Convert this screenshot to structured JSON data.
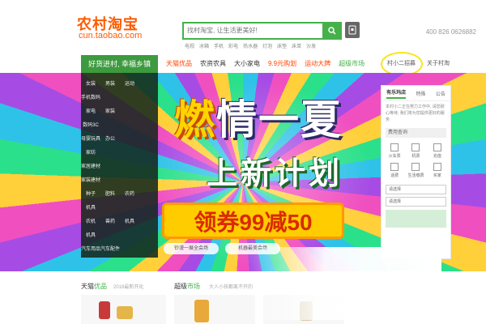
{
  "header": {
    "logo_cn": "农村淘宝",
    "logo_en": "cun.taobao.com",
    "search_placeholder": "找村淘宝, 让生活更美好!",
    "hotwords": [
      "电视",
      "冰箱",
      "手机",
      "彩电",
      "热水器",
      "灯泡",
      "床垫",
      "床单",
      "沙发"
    ],
    "hotline": "400 826 0626882"
  },
  "nav": {
    "categories_label": "好货进村, 幸福乡镇",
    "links": [
      {
        "label": "天猫优品",
        "color": "#ff4400"
      },
      {
        "label": "农资农具",
        "color": "#333333"
      },
      {
        "label": "大小家电",
        "color": "#333333"
      },
      {
        "label": "9.9元购划",
        "color": "#ff4400"
      },
      {
        "label": "运动大牌",
        "color": "#ff4400"
      },
      {
        "label": "超级市场",
        "color": "#46b04a"
      }
    ],
    "right_links": [
      "村小二招募",
      "关于村淘"
    ]
  },
  "sidebar": {
    "rows": [
      [
        "女装",
        "男装",
        "运动"
      ],
      [
        "手机数码",
        "",
        ""
      ],
      [
        "家电",
        "家装",
        ""
      ],
      [
        "数码3C",
        "",
        ""
      ],
      [
        "母婴玩具",
        "办公",
        ""
      ],
      [
        "家纺",
        "",
        ""
      ],
      [
        "家居建材",
        "",
        ""
      ],
      [
        "家装建材",
        "",
        ""
      ],
      [
        "种子",
        "肥料",
        "农药"
      ],
      [
        "机具",
        "",
        ""
      ],
      [
        "农机",
        "兽药",
        "机具"
      ],
      [
        "机具",
        "",
        ""
      ],
      [
        "汽车用品",
        "汽车配件",
        ""
      ]
    ]
  },
  "banner": {
    "headline_accent": "燃",
    "headline": "情一夏",
    "subhead": "上新计划",
    "coupon": "领券99减50",
    "buttons": [
      "钞漫一展全会场",
      "机器最美会场"
    ]
  },
  "right_panel": {
    "tabs": [
      "有乐玛店",
      "特殊",
      "公告"
    ],
    "notice": "本村小二正在努力工作中, 请您耐心等待, 我们将为您提供更好的服务",
    "login_label": "费用查询",
    "grid": [
      "火车票",
      "机票",
      "充值",
      "话费",
      "生活缴费",
      "买家"
    ],
    "select_label": "请选择"
  },
  "lower": {
    "sections": [
      {
        "title_main": "天猫",
        "title_accent": "优品",
        "sub": "2018最新开化"
      },
      {
        "title_main": "超级",
        "title_accent": "市场",
        "sub": "大人小孩都离不开的"
      }
    ]
  },
  "colors": {
    "brand_orange": "#ff5a00",
    "brand_green": "#46b04a",
    "banner_yellow": "#ffcc00"
  },
  "icons": [
    "search-icon",
    "qr-icon",
    "confetti-icon"
  ]
}
